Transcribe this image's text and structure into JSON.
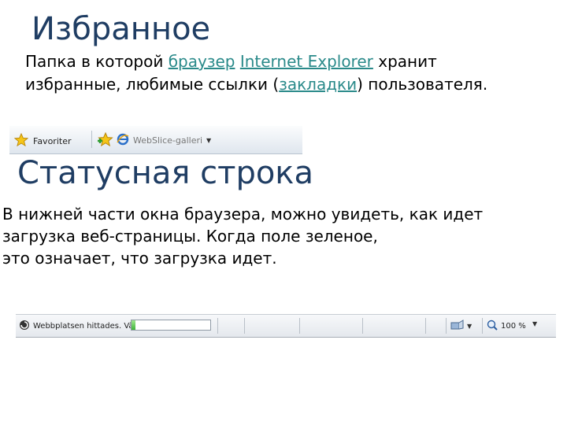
{
  "favorites": {
    "title": "Избранное",
    "line1_prefix": "Папка в которой ",
    "link_browser": "браузер",
    "link_ie": "Internet Explorer",
    "line1_suffix": " хранит",
    "line2_prefix": "избранные, любимые ссылки (",
    "link_bookmarks": "закладки",
    "line2_suffix": ") пользователя."
  },
  "fav_bar": {
    "favorites_label": "Favoriter",
    "slice_label": "WebSlice-galleri"
  },
  "statusbar_section": {
    "title": "Статусная строка",
    "line1": "В нижней части окна браузера, можно увидеть, как идет",
    "line2": "загрузка веб-страницы. Когда поле зеленое,",
    "line3": "это означает, что загрузка идет."
  },
  "status_bar": {
    "status_text": "Webbplatsen hittades. Vä",
    "progress": 0.05,
    "zoom": "100 %"
  },
  "colors": {
    "title": "#1f3d63",
    "link": "#2a8a8a",
    "progress": "#3fb53a"
  }
}
